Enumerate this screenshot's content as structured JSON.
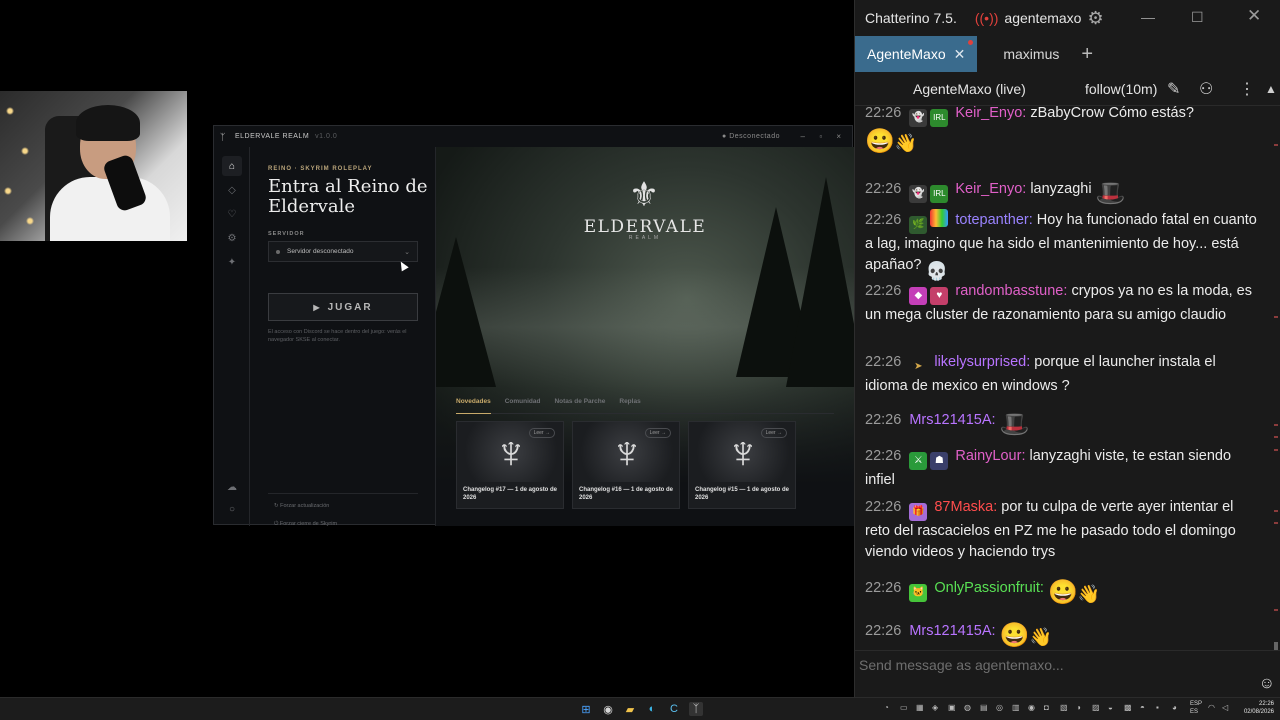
{
  "chatterino": {
    "app_title": "Chatterino 7.5.",
    "account": "agentemaxo",
    "tabs": [
      {
        "label": "AgenteMaxo",
        "active": true
      },
      {
        "label": "maximus",
        "active": false
      }
    ],
    "channel_label": "AgenteMaxo (live)",
    "follow_mode": "follow(10m)",
    "input_placeholder": "Send message as agentemaxo...",
    "messages": [
      {
        "time": "22:26",
        "user": "Keir_Enyo:",
        "text": "zBabyCrow Cómo estás?",
        "badges": [
          "ghost-badge-icon",
          "irl-badge-icon"
        ],
        "emotes": [
          "smiley-emote-icon",
          "wave-emote-icon"
        ]
      },
      {
        "time": "22:26",
        "user": "Keir_Enyo:",
        "text": "lanyzaghi",
        "badges": [
          "ghost-badge-icon",
          "irl-badge-icon"
        ],
        "emotes": [
          "hat-emote-icon"
        ]
      },
      {
        "time": "22:26",
        "user": "totepanther:",
        "text": "Hoy ha funcionado fatal en cuanto a lag, imagino que ha sido el mantenimiento de hoy... está apañao?",
        "badges": [
          "plant-badge-icon",
          "rainbow-badge-icon"
        ],
        "emotes": [
          "skull-emote-icon"
        ]
      },
      {
        "time": "22:26",
        "user": "randombasstune:",
        "text": "crypos ya no es la moda, es un mega cluster de razonamiento para su amigo claudio",
        "badges": [
          "gem-badge-icon",
          "heart-badge-icon"
        ]
      },
      {
        "time": "22:26",
        "user": "likelysurprised:",
        "text": "porque el launcher instala el idioma de mexico en windows ?",
        "badges": [
          "arrow-badge-icon"
        ]
      },
      {
        "time": "22:26",
        "user": "Mrs121415A:",
        "text": "",
        "emotes": [
          "hat-emote-icon"
        ]
      },
      {
        "time": "22:26",
        "user": "RainyLour:",
        "text": "lanyzaghi viste, te estan siendo infiel",
        "badges": [
          "sword-badge-icon",
          "robot-badge-icon"
        ]
      },
      {
        "time": "22:26",
        "user": "87Maska:",
        "text": "por tu culpa de verte ayer intentar el reto del rascacielos en PZ me he pasado todo el domingo viendo videos y haciendo trys",
        "badges": [
          "gift-badge-icon"
        ]
      },
      {
        "time": "22:26",
        "user": "OnlyPassionfruit:",
        "text": "",
        "badges": [
          "cat-badge-icon"
        ],
        "emotes": [
          "smiley-emote-icon",
          "wave-emote-icon"
        ]
      },
      {
        "time": "22:26",
        "user": "Mrs121415A:",
        "text": "",
        "emotes": [
          "smiley-emote-icon",
          "wave-emote-icon"
        ]
      }
    ]
  },
  "launcher": {
    "window_title": "ELDERVALE REALM",
    "version": "v1.0.0",
    "connection_status": "Desconectado",
    "kicker": "REINO · SKYRIM ROLEPLAY",
    "title": "Entra al Reino de Eldervale",
    "server_label": "SERVIDOR",
    "server_value": "Servidor desconectado",
    "play_label": "JUGAR",
    "help_text": "El acceso con Discord se hace dentro del juego: verás el navegador SKSE al conectar.",
    "side_links": [
      "Forzar actualización",
      "Forzar cierre de Skyrim"
    ],
    "brand_name": "ELDERVALE",
    "brand_sub": "REALM",
    "news_tabs": [
      "Novedades",
      "Comunidad",
      "Notas de Parche",
      "Replas"
    ],
    "active_news_tab": "Novedades",
    "cards": [
      {
        "title": "Changelog #17 — 1 de agosto de 2026",
        "tag": "Leer →"
      },
      {
        "title": "Changelog #16 — 1 de agosto de 2026",
        "tag": "Leer →"
      },
      {
        "title": "Changelog #15 — 1 de agosto de 2026",
        "tag": "Leer →"
      }
    ]
  },
  "taskbar": {
    "lang": [
      "ESP",
      "ES"
    ],
    "time": "22:26",
    "date": "02/08/2026"
  },
  "colors": {
    "chat_bg": "#1a1a1a",
    "tab_active": "#3a6b8d",
    "launcher_accent": "#c8aa6a",
    "live_red": "#e0413c"
  }
}
